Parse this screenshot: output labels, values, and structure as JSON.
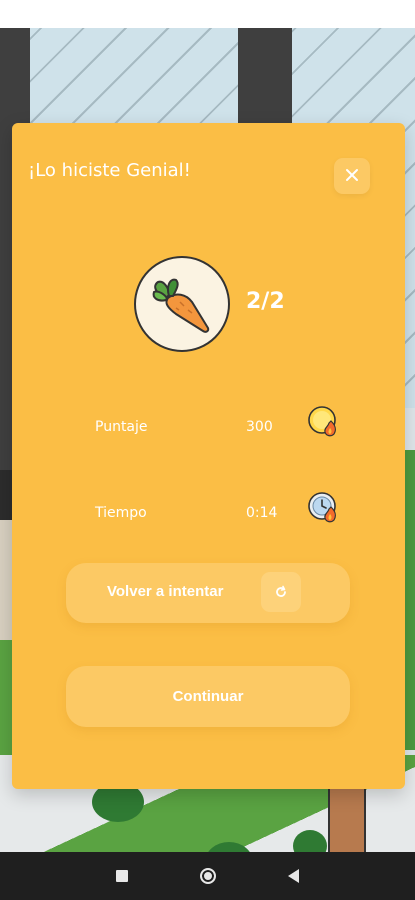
{
  "modal": {
    "title": "¡Lo hiciste Genial!",
    "close_icon": "close-icon",
    "avatar_icon": "carrot-icon",
    "score_count": "2/2"
  },
  "stats": [
    {
      "label": "Puntaje",
      "value": "300",
      "icon": "coin-fire-icon"
    },
    {
      "label": "Tiempo",
      "value": "0:14",
      "icon": "clock-fire-icon"
    }
  ],
  "buttons": {
    "retry_label": "Volver a intentar",
    "retry_icon": "refresh-icon",
    "continue_label": "Continuar"
  },
  "navbar": {
    "items": [
      "recent-apps-icon",
      "home-icon",
      "back-icon"
    ]
  },
  "colors": {
    "modal_bg": "#fbbe45",
    "button_bg": "#fcc964",
    "text": "#ffffff"
  }
}
